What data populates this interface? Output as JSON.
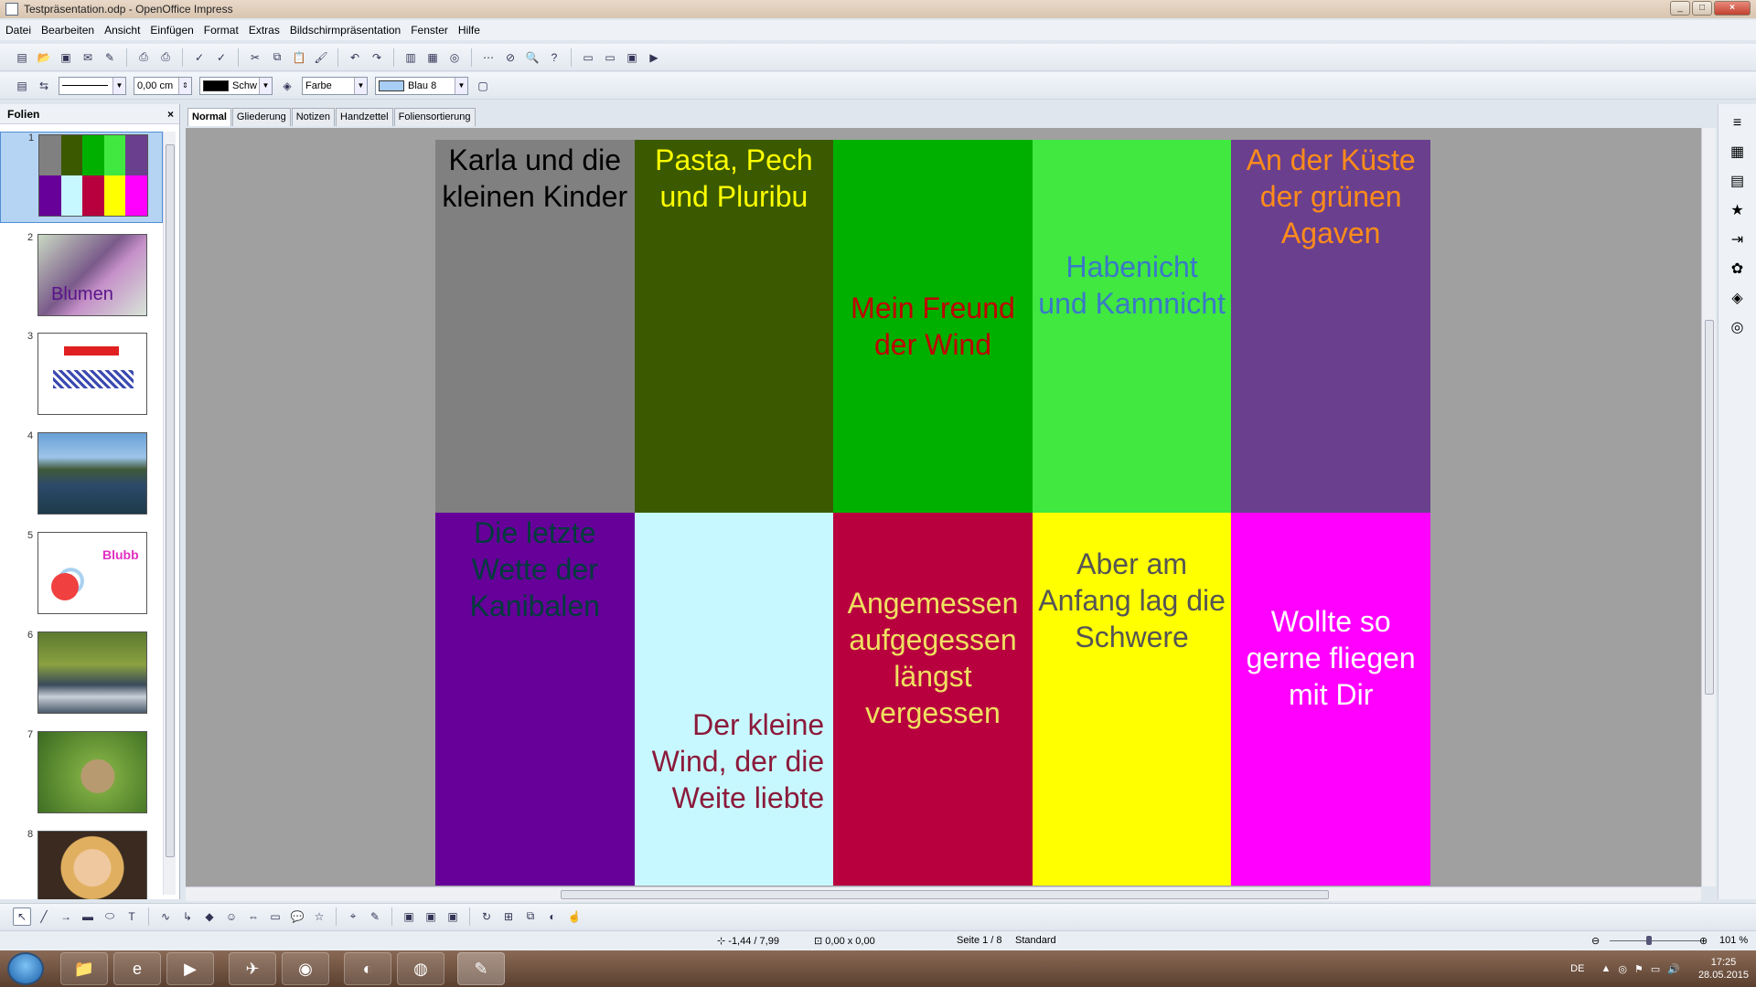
{
  "window": {
    "title": "Testpräsentation.odp - OpenOffice Impress"
  },
  "menu": [
    "Datei",
    "Bearbeiten",
    "Ansicht",
    "Einfügen",
    "Format",
    "Extras",
    "Bildschirmpräsentation",
    "Fenster",
    "Hilfe"
  ],
  "toolbar2": {
    "line_width": "0,00 cm",
    "line_color": "Schw",
    "area_style": "Farbe",
    "area_color": "Blau 8"
  },
  "slides_panel": {
    "title": "Folien",
    "close": "×",
    "slides": [
      {
        "number": "1",
        "label": "",
        "selected": true
      },
      {
        "number": "2",
        "label": "Blumen"
      },
      {
        "number": "3",
        "label": ""
      },
      {
        "number": "4",
        "label": ""
      },
      {
        "number": "5",
        "label": "Blubb"
      },
      {
        "number": "6",
        "label": ""
      },
      {
        "number": "7",
        "label": ""
      },
      {
        "number": "8",
        "label": ""
      }
    ]
  },
  "tabs": [
    "Normal",
    "Gliederung",
    "Notizen",
    "Handzettel",
    "Foliensortierung"
  ],
  "slide": {
    "cells": [
      {
        "text": "Karla und die kleinen Kinder",
        "bg": "#808080",
        "color": "#000000",
        "align": "top"
      },
      {
        "text": "Pasta, Pech und Pluribu",
        "bg": "#3b5a00",
        "color": "#ffff00",
        "align": "top"
      },
      {
        "text": "Mein Freund der Wind",
        "bg": "#00b000",
        "color": "#c00000",
        "align": "middle"
      },
      {
        "text": "Habenicht und Kannnicht",
        "bg": "#40e840",
        "color": "#3a78c8",
        "align": "middle-high"
      },
      {
        "text": "An der Küste der grünen Agaven",
        "bg": "#6a3f8e",
        "color": "#ff8c1a",
        "align": "top"
      },
      {
        "text": "Die letzte Wette der Kanibalen",
        "bg": "#660099",
        "color": "#003c3c",
        "align": "top"
      },
      {
        "text": "Der kleine Wind, der die Weite liebte",
        "bg": "#c8f8ff",
        "color": "#8b1a3a",
        "align": "bottom-right"
      },
      {
        "text": "Angemessen aufgegessen längst vergessen",
        "bg": "#b8003f",
        "color": "#f0e060",
        "align": "middle-high"
      },
      {
        "text": "Aber am Anfang lag die Schwere",
        "bg": "#ffff00",
        "color": "#555555",
        "align": "top-mid"
      },
      {
        "text": "Wollte so gerne fliegen mit Dir",
        "bg": "#ff00ff",
        "color": "#ffffff",
        "align": "middle-high"
      }
    ]
  },
  "statusbar": {
    "position": "-1,44 / 7,99",
    "size": "0,00 x 0,00",
    "page": "Seite 1 / 8",
    "layout": "Standard",
    "zoom": "101 %"
  },
  "taskbar": {
    "lang": "DE",
    "time": "17:25",
    "date": "28.05.2015"
  },
  "colors": {
    "workspace": "#a0a0a0",
    "selection": "#b5d4f3"
  }
}
